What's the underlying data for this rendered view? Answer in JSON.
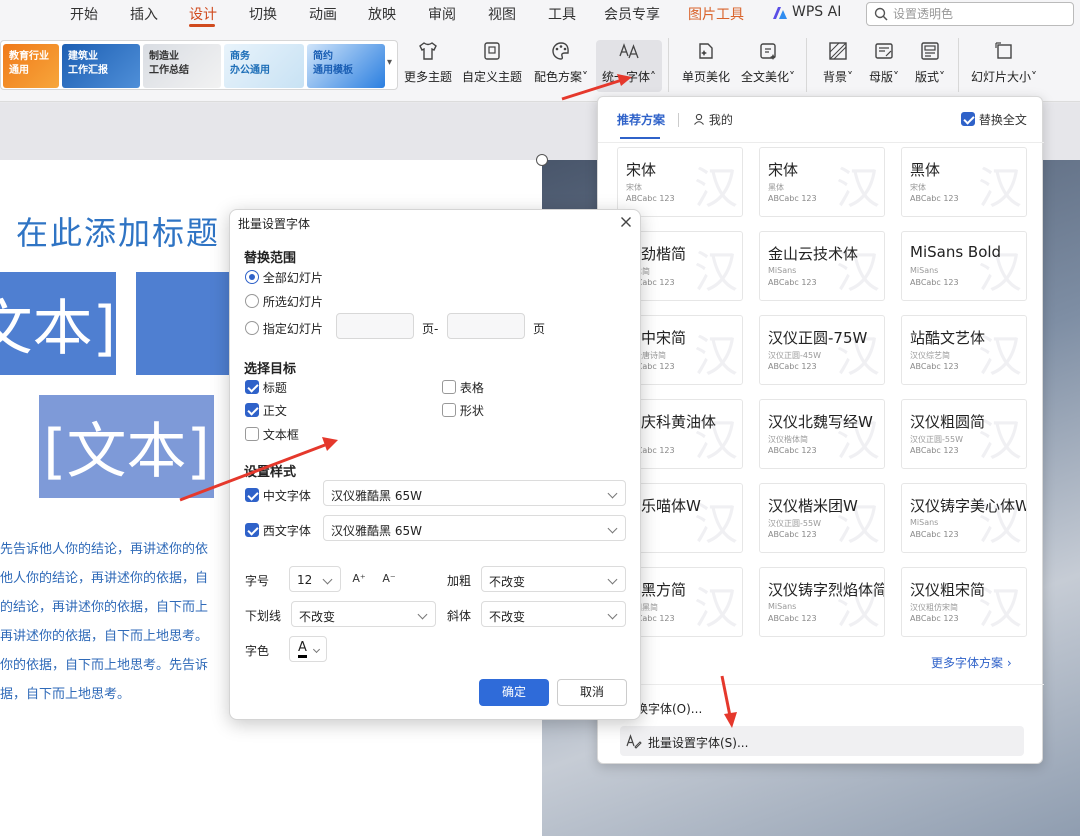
{
  "menu": {
    "items": [
      "开始",
      "插入",
      "设计",
      "切换",
      "动画",
      "放映",
      "审阅",
      "视图",
      "工具",
      "会员专享",
      "图片工具",
      "WPS AI"
    ],
    "active": "设计",
    "search_placeholder": "设置透明色"
  },
  "ribbon": {
    "templates": [
      "教育行业\n通用",
      "建筑业\n工作汇报",
      "制造业\n工作总结",
      "商务\n办公通用",
      "简约\n通用模板"
    ],
    "buttons": {
      "more_themes": "更多主题",
      "custom_theme": "自定义主题",
      "color_scheme": "配色方案˅",
      "unify_font": "统一字体˄",
      "single_page_beautify": "单页美化",
      "full_text_beautify": "全文美化˅",
      "background": "背景˅",
      "master": "母版˅",
      "layout": "版式˅",
      "slide_size": "幻灯片大小˅"
    }
  },
  "slide": {
    "title": "在此添加标题",
    "box1": "文本]",
    "box2": "",
    "box3": "[文本]",
    "body_lines": [
      "先告诉他人你的结论，再讲述你的依",
      "他人你的结论，再讲述你的依据，自",
      "的结论，再讲述你的依据，自下而上",
      "再讲述你的依据，自下而上地思考。",
      "你的依据，自下而上地思考。先告诉",
      "据，自下而上地思考。"
    ]
  },
  "font_panel": {
    "tab_recommended": "推荐方案",
    "tab_mine": "我的",
    "replace_all": "替换全文",
    "fonts": [
      {
        "name": "宋体",
        "sub": "宋体",
        "sample": "ABCabc 123"
      },
      {
        "name": "宋体",
        "sub": "黑体",
        "sample": "ABCabc 123"
      },
      {
        "name": "黑体",
        "sub": "宋体",
        "sample": "ABCabc 123"
      },
      {
        "name": "仪劲楷简",
        "sub": "楷体简",
        "sample": "ABCabc 123"
      },
      {
        "name": "金山云技术体",
        "sub": "MiSans",
        "sample": "ABCabc 123"
      },
      {
        "name": "MiSans Bold",
        "sub": "MiSans",
        "sample": "ABCabc 123"
      },
      {
        "name": "仪中宋简",
        "sub": "仪全唐诗简",
        "sample": "ABCabc 123"
      },
      {
        "name": "汉仪正圆-75W",
        "sub": "汉仪正圆-45W",
        "sample": "ABCabc 123"
      },
      {
        "name": "站酷文艺体",
        "sub": "汉仪综艺简",
        "sample": "ABCabc 123"
      },
      {
        "name": "酷庆科黄油体",
        "sub": "ns",
        "sample": "ABCabc 123"
      },
      {
        "name": "汉仪北魏写经W",
        "sub": "汉仪楷体简",
        "sample": "ABCabc 123"
      },
      {
        "name": "汉仪粗圆简",
        "sub": "汉仪正圆-55W",
        "sample": "ABCabc 123"
      },
      {
        "name": "仪乐喵体W",
        "sub": "",
        "sample": "123"
      },
      {
        "name": "汉仪楷米团W",
        "sub": "汉仪正圆-55W",
        "sample": "ABCabc 123"
      },
      {
        "name": "汉仪铸字美心体W",
        "sub": "MiSans",
        "sample": "ABCabc 123"
      },
      {
        "name": "汉黑方简",
        "sub": "中国黑简",
        "sample": "ABCabc 123"
      },
      {
        "name": "汉仪铸字烈焰体简",
        "sub": "MiSans",
        "sample": "ABCabc 123"
      },
      {
        "name": "汉仪粗宋简",
        "sub": "汉仪粗仿宋简",
        "sample": "ABCabc 123"
      }
    ],
    "more_schemes": "更多字体方案",
    "replace_font": "替换字体(O)...",
    "batch_set_font": "批量设置字体(S)..."
  },
  "dialog": {
    "title": "批量设置字体",
    "scope_title": "替换范围",
    "scope_all": "全部幻灯片",
    "scope_selected": "所选幻灯片",
    "scope_specified": "指定幻灯片",
    "page_dash": "页-",
    "page": "页",
    "target_title": "选择目标",
    "target_title_item": "标题",
    "target_body": "正文",
    "target_textbox": "文本框",
    "target_table": "表格",
    "target_shape": "形状",
    "style_title": "设置样式",
    "chinese_font_label": "中文字体",
    "chinese_font_value": "汉仪雅酷黑 65W",
    "western_font_label": "西文字体",
    "western_font_value": "汉仪雅酷黑 65W",
    "size_label": "字号",
    "size_value": "12",
    "grow_icon": "A⁺",
    "shrink_icon": "A⁻",
    "bold_label": "加粗",
    "bold_value": "不改变",
    "underline_label": "下划线",
    "underline_value": "不改变",
    "italic_label": "斜体",
    "italic_value": "不改变",
    "color_label": "字色",
    "color_glyph": "A",
    "ok": "确定",
    "cancel": "取消"
  },
  "colors": {
    "accent_blue": "#2f62c9",
    "active_tab": "#d04a1e",
    "annotation_arrow": "#e5382c"
  }
}
